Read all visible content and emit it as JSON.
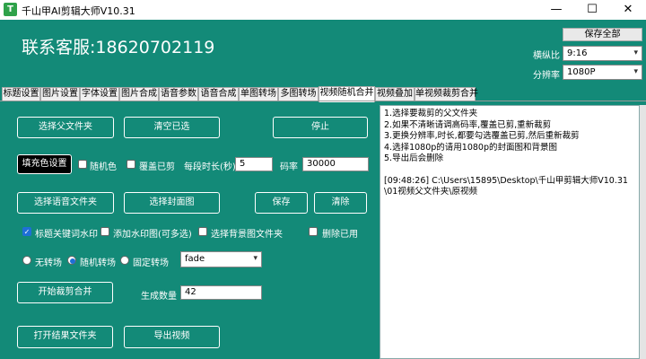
{
  "window": {
    "title": "千山甲AI剪辑大师V10.31",
    "icon_letter": "T",
    "min_glyph": "—",
    "max_glyph": "☐",
    "close_glyph": "✕"
  },
  "header": {
    "contact": "联系客服:18620702119",
    "save_all": "保存全部",
    "aspect_label": "横纵比",
    "aspect_value": "9:16",
    "resolution_label": "分辨率",
    "resolution_value": "1080P"
  },
  "tabs": [
    {
      "label": "标题设置"
    },
    {
      "label": "图片设置"
    },
    {
      "label": "字体设置"
    },
    {
      "label": "图片合成"
    },
    {
      "label": "语音参数"
    },
    {
      "label": "语音合成"
    },
    {
      "label": "单图转场"
    },
    {
      "label": "多图转场"
    },
    {
      "label": "视频随机合并",
      "active": true
    },
    {
      "label": "视频叠加"
    },
    {
      "label": "单视频裁剪合并"
    }
  ],
  "panel": {
    "select_parent_btn": "选择父文件夹",
    "clear_selected_btn": "清空已选",
    "stop_btn": "停止",
    "fill_color_btn": "填充色设置",
    "random_color_label": "随机色",
    "random_color_checked": false,
    "overwrite_clipped_label": "覆盖已剪",
    "overwrite_clipped_checked": false,
    "duration_label": "每段时长(秒)",
    "duration_value": "5",
    "bitrate_label": "码率",
    "bitrate_value": "30000",
    "select_voice_btn": "选择语音文件夹",
    "select_cover_btn": "选择封面图",
    "save_btn": "保存",
    "clear_btn": "清除",
    "keyword_watermark_label": "标题关键词水印",
    "keyword_watermark_checked": true,
    "add_watermark_label": "添加水印图(可多选)",
    "add_watermark_checked": false,
    "bg_folder_label": "选择背景图文件夹",
    "bg_folder_checked": false,
    "delete_used_label": "删除已用",
    "delete_used_checked": false,
    "no_transition_label": "无转场",
    "random_transition_label": "随机转场",
    "fixed_transition_label": "固定转场",
    "transition_selected": "random",
    "transition_value": "fade",
    "start_btn": "开始裁剪合并",
    "count_label": "生成数量",
    "count_value": "42",
    "open_result_btn": "打开结果文件夹",
    "export_video_btn": "导出视频"
  },
  "log": {
    "lines": [
      "1.选择要裁剪的父文件夹",
      "2.如果不清晰请调高码率,覆盖已剪,重新裁剪",
      "3.更换分辨率,时长,都要勾选覆盖已剪,然后重新裁剪",
      "4.选择1080p的请用1080p的封面图和背景图",
      "5.导出后会删除",
      "",
      "[09:48:26] C:\\Users\\15895\\Desktop\\千山甲剪辑大师V10.31\\01视频父文件夹\\原视频"
    ]
  },
  "colors": {
    "background": "#138a78",
    "accent_blue": "#1e6fd6"
  }
}
